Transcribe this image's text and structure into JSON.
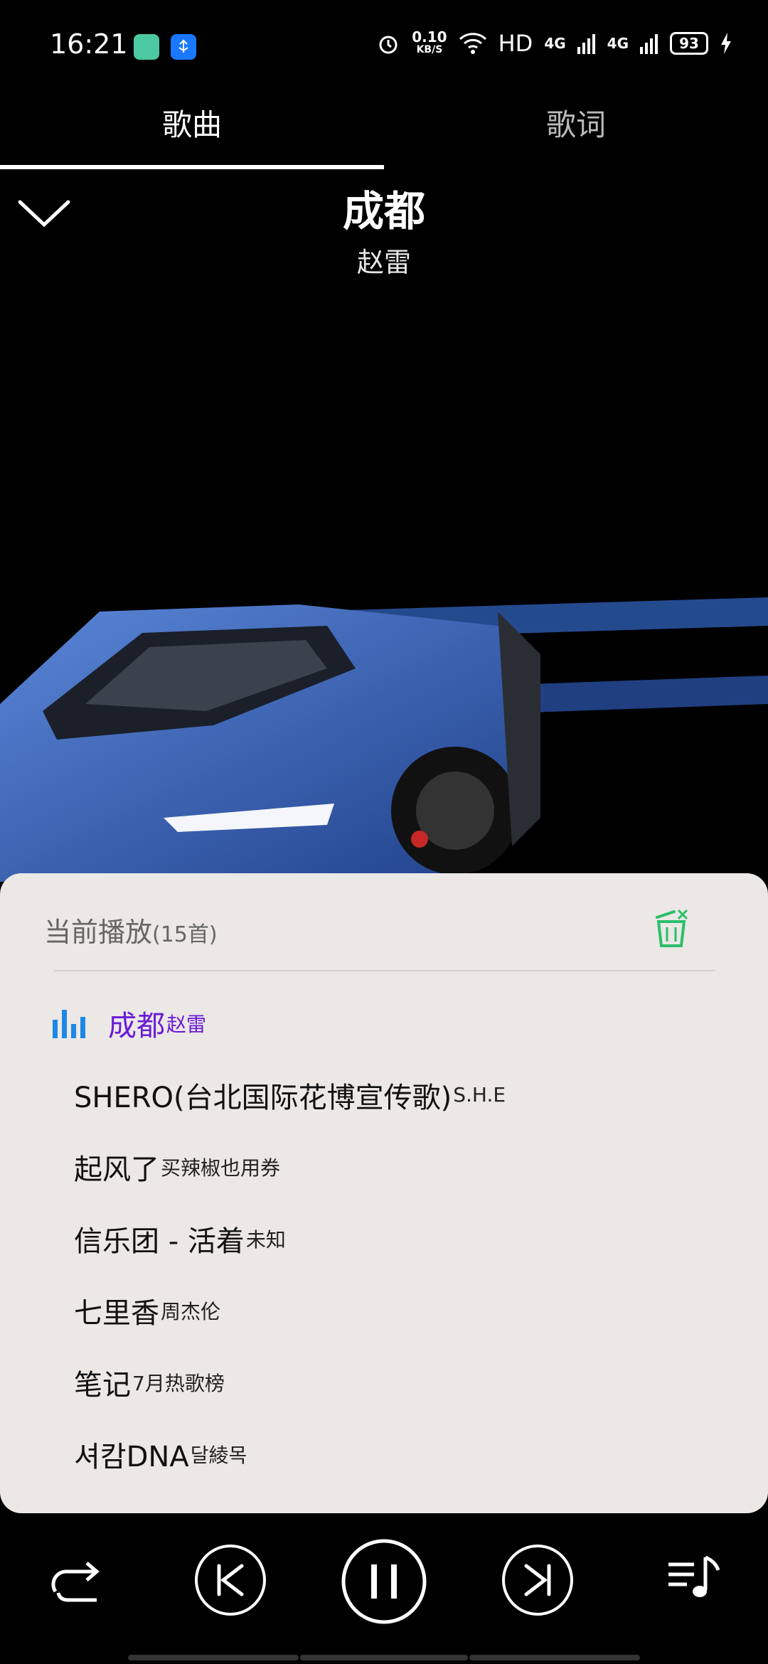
{
  "status_bar": {
    "time": "16:21",
    "net_speed_value": "0.10",
    "net_speed_unit": "KB/S",
    "hd_label": "HD",
    "sim1_label": "4G",
    "sim2_label": "4G",
    "battery": "93"
  },
  "tabs": [
    {
      "label": "歌曲",
      "active": true
    },
    {
      "label": "歌词",
      "active": false
    }
  ],
  "now_playing": {
    "title": "成都",
    "artist": "赵雷"
  },
  "playlist": {
    "header": "当前播放",
    "count": "(15首)",
    "items": [
      {
        "title": "成都",
        "artist": "赵雷",
        "current": true
      },
      {
        "title": "SHERO(台北国际花博宣传歌)",
        "artist": "S.H.E"
      },
      {
        "title": "起风了",
        "artist": "买辣椒也用券"
      },
      {
        "title": "信乐团 - 活着",
        "artist": "未知"
      },
      {
        "title": "七里香",
        "artist": "周杰伦"
      },
      {
        "title": "笔记",
        "artist": "7月热歌榜"
      },
      {
        "title": "셔캄DNA",
        "artist": "달綾목"
      }
    ]
  },
  "colors": {
    "accent_current": "#6a1bd6",
    "trash_green": "#2bbf6a",
    "eq_blue": "#1e88e5"
  },
  "icons": [
    "collapse-chevron-icon",
    "trash-icon",
    "equalizer-icon",
    "repeat-icon",
    "previous-icon",
    "pause-icon",
    "next-icon",
    "playlist-icon"
  ]
}
